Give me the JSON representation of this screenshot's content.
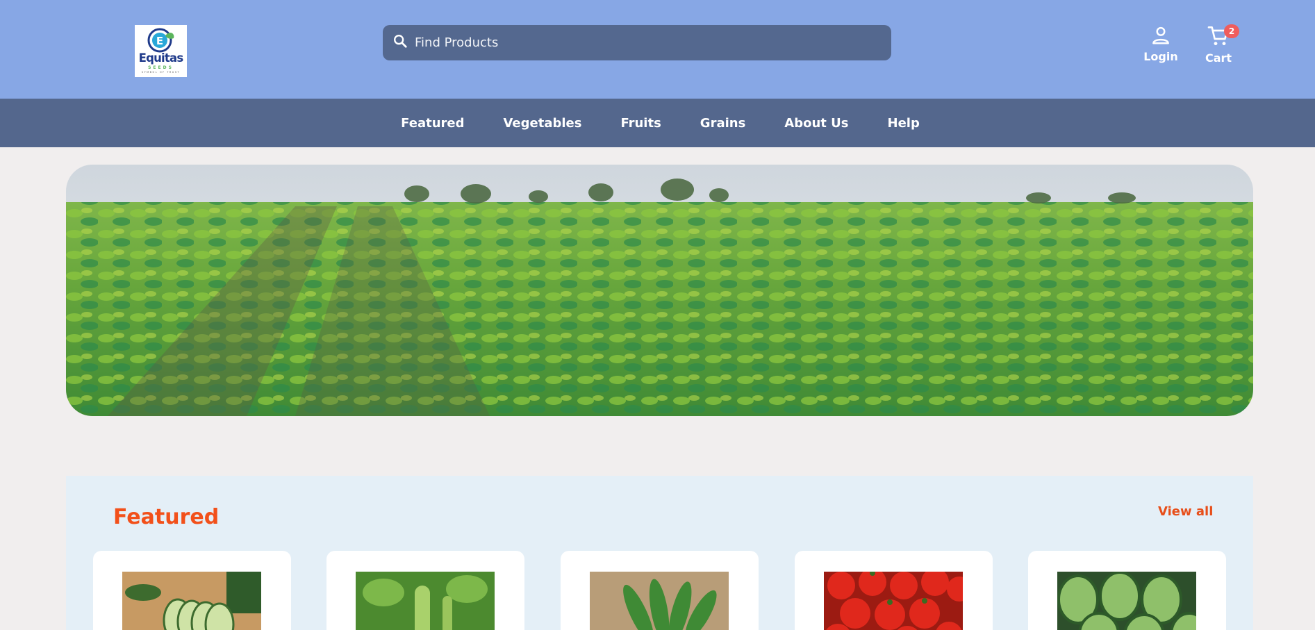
{
  "brand": {
    "logo_name": "Equitas",
    "logo_sub": "SEEDS",
    "logo_tagline": "SYMBOL OF TRUST",
    "logo_mark": "EC"
  },
  "search": {
    "placeholder": "Find Products",
    "icon": "search-icon"
  },
  "header_actions": {
    "login_label": "Login",
    "cart_label": "Cart",
    "cart_count": "2"
  },
  "nav": {
    "items": [
      {
        "label": "Featured"
      },
      {
        "label": "Vegetables"
      },
      {
        "label": "Fruits"
      },
      {
        "label": "Grains"
      },
      {
        "label": "About Us"
      },
      {
        "label": "Help"
      }
    ]
  },
  "hero": {
    "image": "green-crop-field-banner"
  },
  "featured": {
    "title": "Featured",
    "view_all_label": "View all",
    "products": [
      {
        "image": "cucumber-image"
      },
      {
        "image": "bottle-gourd-image"
      },
      {
        "image": "okra-image"
      },
      {
        "image": "tomato-image"
      },
      {
        "image": "watermelon-image"
      }
    ]
  },
  "colors": {
    "header_bg": "#87a7e5",
    "nav_bg": "#54678d",
    "search_bg": "#54688f",
    "page_bg": "#f1eeee",
    "featured_bg": "#e4eff7",
    "accent": "#f2501a",
    "badge": "#ef5d5d"
  }
}
